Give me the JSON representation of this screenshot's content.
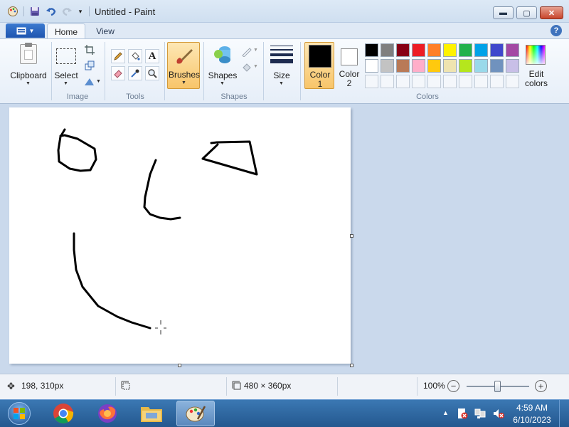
{
  "window": {
    "title": "Untitled - Paint"
  },
  "tabs": {
    "home": "Home",
    "view": "View"
  },
  "ribbon": {
    "clipboard_label": "Clipboard",
    "select_label": "Select",
    "image_group": "Image",
    "tools_group": "Tools",
    "brushes_label": "Brushes",
    "shapes_label": "Shapes",
    "shapes_group": "Shapes",
    "size_label": "Size",
    "color1_label": "Color",
    "color1_num": "1",
    "color2_label": "Color",
    "color2_num": "2",
    "colors_group": "Colors",
    "edit_colors_line1": "Edit",
    "edit_colors_line2": "colors",
    "color1_value": "#000000",
    "color2_value": "#ffffff"
  },
  "palette": {
    "row1": [
      "#000000",
      "#7f7f7f",
      "#880015",
      "#ed1c24",
      "#ff7f27",
      "#fff200",
      "#22b14c",
      "#00a2e8",
      "#3f48cc",
      "#a349a4"
    ],
    "row2": [
      "#ffffff",
      "#c3c3c3",
      "#b97a57",
      "#ffaec9",
      "#ffc90e",
      "#efe4b0",
      "#b5e61d",
      "#99d9ea",
      "#7092be",
      "#c8bfe7"
    ]
  },
  "status": {
    "cursor_pos": "198, 310px",
    "canvas_size": "480 × 360px",
    "zoom": "100%",
    "zoom_level": 0.5
  },
  "taskbar": {
    "time": "4:59 AM",
    "date": "6/10/2023",
    "apps": [
      "start-button",
      "chrome",
      "firefox",
      "file-explorer",
      "paint"
    ]
  }
}
